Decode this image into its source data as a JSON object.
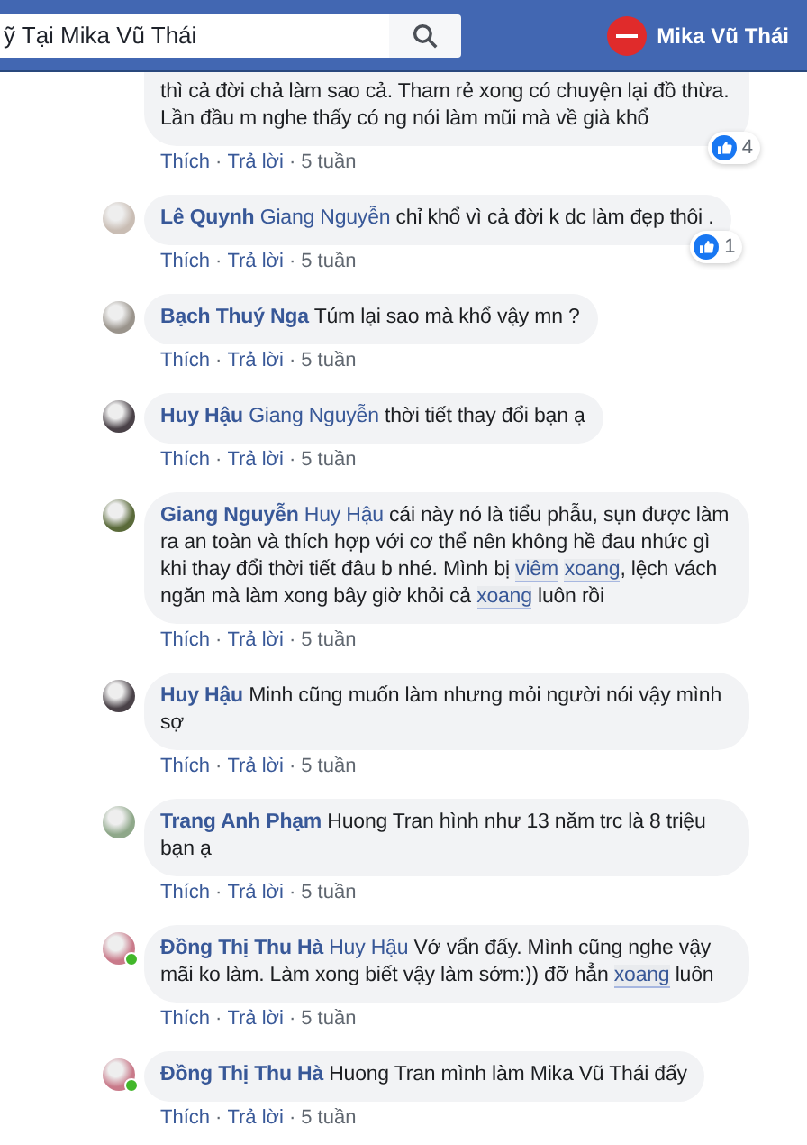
{
  "header": {
    "search_value": "ỹ Tại Mika Vũ Thái",
    "profile_name": "Mika Vũ Thái"
  },
  "comments": [
    {
      "cut_top": true,
      "online": false,
      "segments": [
        {
          "kind": "plain",
          "text": "thì cả đời chả làm sao cả. Tham rẻ xong có chuyện lại đồ thừa. Lần đầu m nghe thấy có ng nói làm mũi mà về già khổ"
        }
      ],
      "reactions": "4",
      "actions": [
        {
          "kind": "link",
          "text": "Thích"
        },
        {
          "kind": "sep",
          "text": "·"
        },
        {
          "kind": "link",
          "text": "Trả lời"
        },
        {
          "kind": "sep",
          "text": "·"
        },
        {
          "kind": "time",
          "text": "5 tuần"
        }
      ]
    },
    {
      "author": "Lê Quynh",
      "cut_top": false,
      "online": false,
      "segments": [
        {
          "kind": "tag",
          "text": "Giang Nguyễn"
        },
        {
          "kind": "plain",
          "text": " chỉ khổ vì cả đời k dc làm đẹp thôi ."
        }
      ],
      "reactions": "1",
      "actions": [
        {
          "kind": "link",
          "text": "Thích"
        },
        {
          "kind": "sep",
          "text": "·"
        },
        {
          "kind": "link",
          "text": "Trả lời"
        },
        {
          "kind": "sep",
          "text": "·"
        },
        {
          "kind": "time",
          "text": "5 tuần"
        }
      ]
    },
    {
      "author": "Bạch Thuý Nga",
      "cut_top": false,
      "online": false,
      "segments": [
        {
          "kind": "plain",
          "text": "Túm lại sao mà khổ vậy mn ?"
        }
      ],
      "actions": [
        {
          "kind": "link",
          "text": "Thích"
        },
        {
          "kind": "sep",
          "text": "·"
        },
        {
          "kind": "link",
          "text": "Trả lời"
        },
        {
          "kind": "sep",
          "text": "·"
        },
        {
          "kind": "time",
          "text": "5 tuần"
        }
      ]
    },
    {
      "author": "Huy Hậu",
      "cut_top": false,
      "online": false,
      "segments": [
        {
          "kind": "tag",
          "text": "Giang Nguyễn"
        },
        {
          "kind": "plain",
          "text": " thời tiết thay đổi bạn ạ"
        }
      ],
      "actions": [
        {
          "kind": "link",
          "text": "Thích"
        },
        {
          "kind": "sep",
          "text": "·"
        },
        {
          "kind": "link",
          "text": "Trả lời"
        },
        {
          "kind": "sep",
          "text": "·"
        },
        {
          "kind": "time",
          "text": "5 tuần"
        }
      ]
    },
    {
      "author": "Giang Nguyễn",
      "cut_top": false,
      "online": false,
      "segments": [
        {
          "kind": "tag",
          "text": "Huy Hậu"
        },
        {
          "kind": "plain",
          "text": " cái này nó là tiểu phẫu, sụn được làm ra an toàn và thích hợp với cơ thể nên không hề đau nhức gì khi thay đổi thời tiết đâu b nhé. Mình bị "
        },
        {
          "kind": "keyword",
          "text": "viêm"
        },
        {
          "kind": "keyword",
          "text": "xoang"
        },
        {
          "kind": "plain",
          "text": ", lệch vách ngăn mà làm xong bây giờ khỏi cả "
        },
        {
          "kind": "keyword",
          "text": "xoang"
        },
        {
          "kind": "plain",
          "text": " luôn rồi"
        }
      ],
      "actions": [
        {
          "kind": "link",
          "text": "Thích"
        },
        {
          "kind": "sep",
          "text": "·"
        },
        {
          "kind": "link",
          "text": "Trả lời"
        },
        {
          "kind": "sep",
          "text": "·"
        },
        {
          "kind": "time",
          "text": "5 tuần"
        }
      ]
    },
    {
      "author": "Huy Hậu",
      "cut_top": false,
      "online": false,
      "segments": [
        {
          "kind": "plain",
          "text": "Minh cũng muốn làm nhưng mỏi người nói vậy mình sợ"
        }
      ],
      "actions": [
        {
          "kind": "link",
          "text": "Thích"
        },
        {
          "kind": "sep",
          "text": "·"
        },
        {
          "kind": "link",
          "text": "Trả lời"
        },
        {
          "kind": "sep",
          "text": "·"
        },
        {
          "kind": "time",
          "text": "5 tuần"
        }
      ]
    },
    {
      "author": "Trang Anh Phạm",
      "cut_top": false,
      "online": false,
      "segments": [
        {
          "kind": "plain",
          "text": "Huong Tran hình như 13 năm trc là 8 triệu bạn ạ"
        }
      ],
      "actions": [
        {
          "kind": "link",
          "text": "Thích"
        },
        {
          "kind": "sep",
          "text": "·"
        },
        {
          "kind": "link",
          "text": "Trả lời"
        },
        {
          "kind": "sep",
          "text": "·"
        },
        {
          "kind": "time",
          "text": "5 tuần"
        }
      ]
    },
    {
      "author": "Đồng Thị Thu Hà",
      "cut_top": false,
      "online": true,
      "segments": [
        {
          "kind": "tag",
          "text": "Huy Hậu"
        },
        {
          "kind": "plain",
          "text": " Vớ vẩn đấy. Mình cũng nghe vậy mãi ko làm. Làm xong biết vậy làm sớm:)) đỡ hẳn "
        },
        {
          "kind": "keyword",
          "text": "xoang"
        },
        {
          "kind": "plain",
          "text": " luôn"
        }
      ],
      "actions": [
        {
          "kind": "link",
          "text": "Thích"
        },
        {
          "kind": "sep",
          "text": "·"
        },
        {
          "kind": "link",
          "text": "Trả lời"
        },
        {
          "kind": "sep",
          "text": "·"
        },
        {
          "kind": "time",
          "text": "5 tuần"
        }
      ]
    },
    {
      "author": "Đồng Thị Thu Hà",
      "cut_top": false,
      "online": true,
      "segments": [
        {
          "kind": "plain",
          "text": "Huong Tran mình làm Mika Vũ Thái đấy"
        }
      ],
      "actions": [
        {
          "kind": "link",
          "text": "Thích"
        },
        {
          "kind": "sep",
          "text": "·"
        },
        {
          "kind": "link",
          "text": "Trả lời"
        },
        {
          "kind": "sep",
          "text": "·"
        },
        {
          "kind": "time",
          "text": "5 tuần"
        }
      ]
    }
  ]
}
